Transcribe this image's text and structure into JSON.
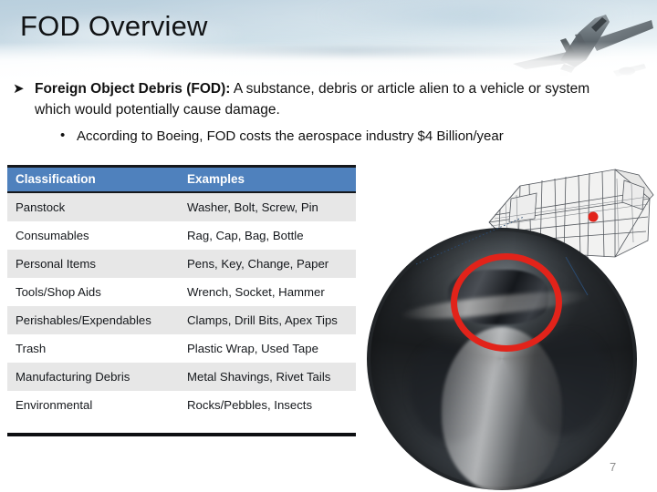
{
  "slide": {
    "title": "FOD Overview",
    "page_number": "7"
  },
  "bullets": {
    "level1": {
      "marker": "➤",
      "bold_lead": "Foreign Object Debris (FOD):",
      "text": " A substance, debris or article alien to a vehicle or system which would potentially cause damage."
    },
    "level2": {
      "marker": "•",
      "text": "According to Boeing, FOD costs the aerospace industry $4 Billion/year"
    }
  },
  "table": {
    "headers": [
      "Classification",
      "Examples"
    ],
    "header_bg": "#4f81bd",
    "header_text_color": "#ffffff",
    "alt_row_bg": "#e7e7e7",
    "rows": [
      {
        "classification": "Panstock",
        "examples": "Washer, Bolt, Screw, Pin"
      },
      {
        "classification": "Consumables",
        "examples": "Rag, Cap, Bag, Bottle"
      },
      {
        "classification": "Personal Items",
        "examples": "Pens, Key, Change, Paper"
      },
      {
        "classification": "Tools/Shop Aids",
        "examples": "Wrench, Socket, Hammer"
      },
      {
        "classification": "Perishables/Expendables",
        "examples": "Clamps, Drill Bits, Apex Tips"
      },
      {
        "classification": "Trash",
        "examples": "Plastic Wrap, Used Tape"
      },
      {
        "classification": "Manufacturing Debris",
        "examples": "Metal Shavings, Rivet Tails"
      },
      {
        "classification": "Environmental",
        "examples": "Rocks/Pebbles, Insects"
      }
    ]
  },
  "artwork": {
    "banner_image": "fighter-jet-in-clouds-photo",
    "engine_drawing": "jet-engine-wireframe-cad-drawing",
    "inspection_photo": "engine-interior-fod-damage-photo",
    "highlight_color": "#e2231a",
    "callout_line_color": "#2b4a6f"
  }
}
